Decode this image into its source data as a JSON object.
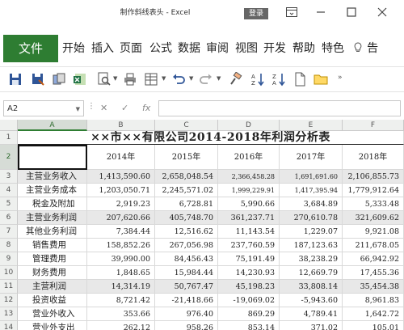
{
  "window": {
    "title": "制作斜线表头 - Excel",
    "login_label": "登录"
  },
  "ribbon": {
    "file_label": "文件",
    "tabs": [
      "开始",
      "插入",
      "页面",
      "公式",
      "数据",
      "审阅",
      "视图",
      "开发",
      "帮助",
      "特色"
    ],
    "tell_label": "告"
  },
  "formula_bar": {
    "name_box": "A2",
    "fx_label": "fx",
    "formula": ""
  },
  "grid": {
    "columns": [
      "A",
      "B",
      "C",
      "D",
      "E",
      "F"
    ],
    "row_numbers": [
      "1",
      "2",
      "3",
      "4",
      "5",
      "6",
      "7",
      "8",
      "9",
      "10",
      "11",
      "12",
      "13",
      "14"
    ],
    "title": "××市××有限公司2014-2018年利润分析表",
    "years": [
      "2014年",
      "2015年",
      "2016年",
      "2017年",
      "2018年"
    ],
    "rows": [
      {
        "label": "主营业务收入",
        "values": [
          "1,413,590.60",
          "2,658,048.54",
          "2,366,458.28",
          "1,691,691.60",
          "2,106,855.73"
        ]
      },
      {
        "label": "主营业务成本",
        "values": [
          "1,203,050.71",
          "2,245,571.02",
          "1,999,229.91",
          "1,417,395.94",
          "1,779,912.64"
        ]
      },
      {
        "label": "税金及附加",
        "values": [
          "2,919.23",
          "6,728.81",
          "5,990.66",
          "3,684.89",
          "5,333.48"
        ]
      },
      {
        "label": "主营业务利润",
        "values": [
          "207,620.66",
          "405,748.70",
          "361,237.71",
          "270,610.78",
          "321,609.62"
        ]
      },
      {
        "label": "其他业务利润",
        "values": [
          "7,384.44",
          "12,516.62",
          "11,143.54",
          "1,229.07",
          "9,921.08"
        ]
      },
      {
        "label": "销售费用",
        "values": [
          "158,852.26",
          "267,056.98",
          "237,760.59",
          "187,123.63",
          "211,678.05"
        ]
      },
      {
        "label": "管理费用",
        "values": [
          "39,990.00",
          "84,456.43",
          "75,191.49",
          "38,238.29",
          "66,942.92"
        ]
      },
      {
        "label": "财务费用",
        "values": [
          "1,848.65",
          "15,984.44",
          "14,230.93",
          "12,669.79",
          "17,455.36"
        ]
      },
      {
        "label": "主营利润",
        "values": [
          "14,314.19",
          "50,767.47",
          "45,198.23",
          "33,808.14",
          "35,454.38"
        ]
      },
      {
        "label": "投资收益",
        "values": [
          "8,721.42",
          "-21,418.66",
          "-19,069.02",
          "-5,943.60",
          "8,961.83"
        ]
      },
      {
        "label": "营业外收入",
        "values": [
          "353.66",
          "976.40",
          "869.29",
          "4,789.41",
          "1,642.72"
        ]
      },
      {
        "label": "营业外支出",
        "values": [
          "262.12",
          "958.26",
          "853.14",
          "371.02",
          "105.01"
        ]
      }
    ]
  }
}
